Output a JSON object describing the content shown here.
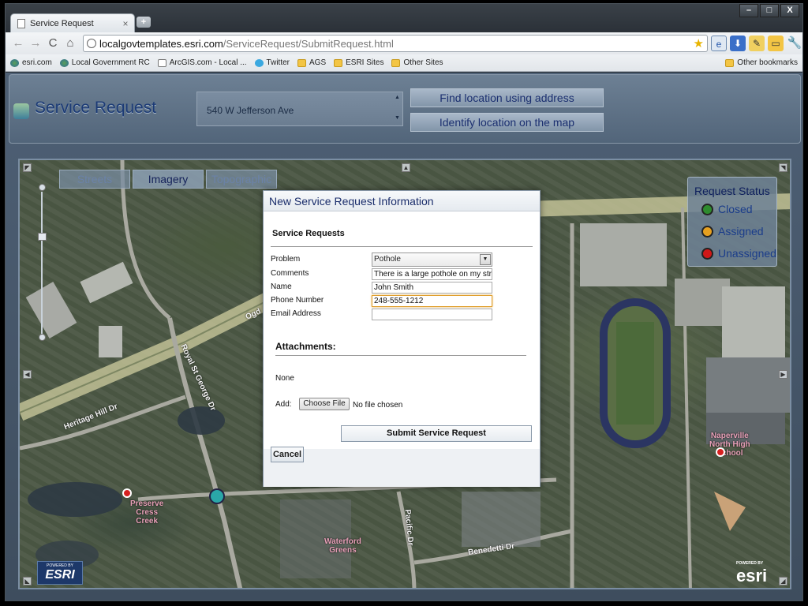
{
  "browser": {
    "tab_title": "Service Request",
    "tab_close": "×",
    "new_tab": "+",
    "window_controls": [
      "–",
      "□",
      "X"
    ],
    "nav": {
      "back": "←",
      "forward": "→",
      "reload": "C",
      "home": "⌂"
    },
    "url_host": "localgovtemplates.esri.com",
    "url_path": "/ServiceRequest/SubmitRequest.html",
    "bookmarks": [
      {
        "label": "esri.com",
        "icon": "earth"
      },
      {
        "label": "Local Government RC",
        "icon": "earth"
      },
      {
        "label": "ArcGIS.com - Local ...",
        "icon": "page"
      },
      {
        "label": "Twitter",
        "icon": "bird"
      },
      {
        "label": "AGS",
        "icon": "folder"
      },
      {
        "label": "ESRI Sites",
        "icon": "folder"
      },
      {
        "label": "Other Sites",
        "icon": "folder"
      }
    ],
    "other_bookmarks": "Other bookmarks"
  },
  "header": {
    "title": "Service Request",
    "address_value": "540 W Jefferson Ave",
    "find_button": "Find location using address",
    "identify_button": "Identify location on the map"
  },
  "map": {
    "basemap_tabs": [
      {
        "label": "Streets",
        "active": false
      },
      {
        "label": "Imagery",
        "active": true
      },
      {
        "label": "Topographic",
        "active": false
      }
    ],
    "legend": {
      "title": "Request Status",
      "items": [
        {
          "label": "Closed",
          "color": "#2e8b2e"
        },
        {
          "label": "Assigned",
          "color": "#e6a020"
        },
        {
          "label": "Unassigned",
          "color": "#d01818"
        }
      ]
    },
    "street_labels": {
      "heritage_hill": "Heritage Hill Dr",
      "royal_st_george": "Royal St George Dr",
      "pacific": "Pacific Dr",
      "benedetti": "Benedetti Dr",
      "ogden": "Ogd"
    },
    "place_labels": {
      "preserve": [
        "Preserve",
        "Cress",
        "Creek"
      ],
      "waterford": [
        "Waterford",
        "Greens"
      ],
      "naperville": [
        "Naperville",
        "North High",
        "School"
      ]
    },
    "esri_badge_small": "POWERED BY",
    "esri_badge_big": "ESRI",
    "esri_logo_small": "POWERED BY",
    "esri_logo_big": "esri"
  },
  "dialog": {
    "title": "New Service Request Information",
    "section_requests": "Service Requests",
    "labels": {
      "problem": "Problem",
      "comments": "Comments",
      "name": "Name",
      "phone": "Phone Number",
      "email": "Email Address"
    },
    "values": {
      "problem": "Pothole",
      "comments": "There is a large pothole on my street",
      "name": "John Smith",
      "phone": "248-555-1212",
      "email": ""
    },
    "section_attachments": "Attachments:",
    "attachments_none": "None",
    "add_label": "Add:",
    "choose_file": "Choose File",
    "no_file": "No file chosen",
    "submit": "Submit Service Request",
    "cancel": "Cancel"
  }
}
